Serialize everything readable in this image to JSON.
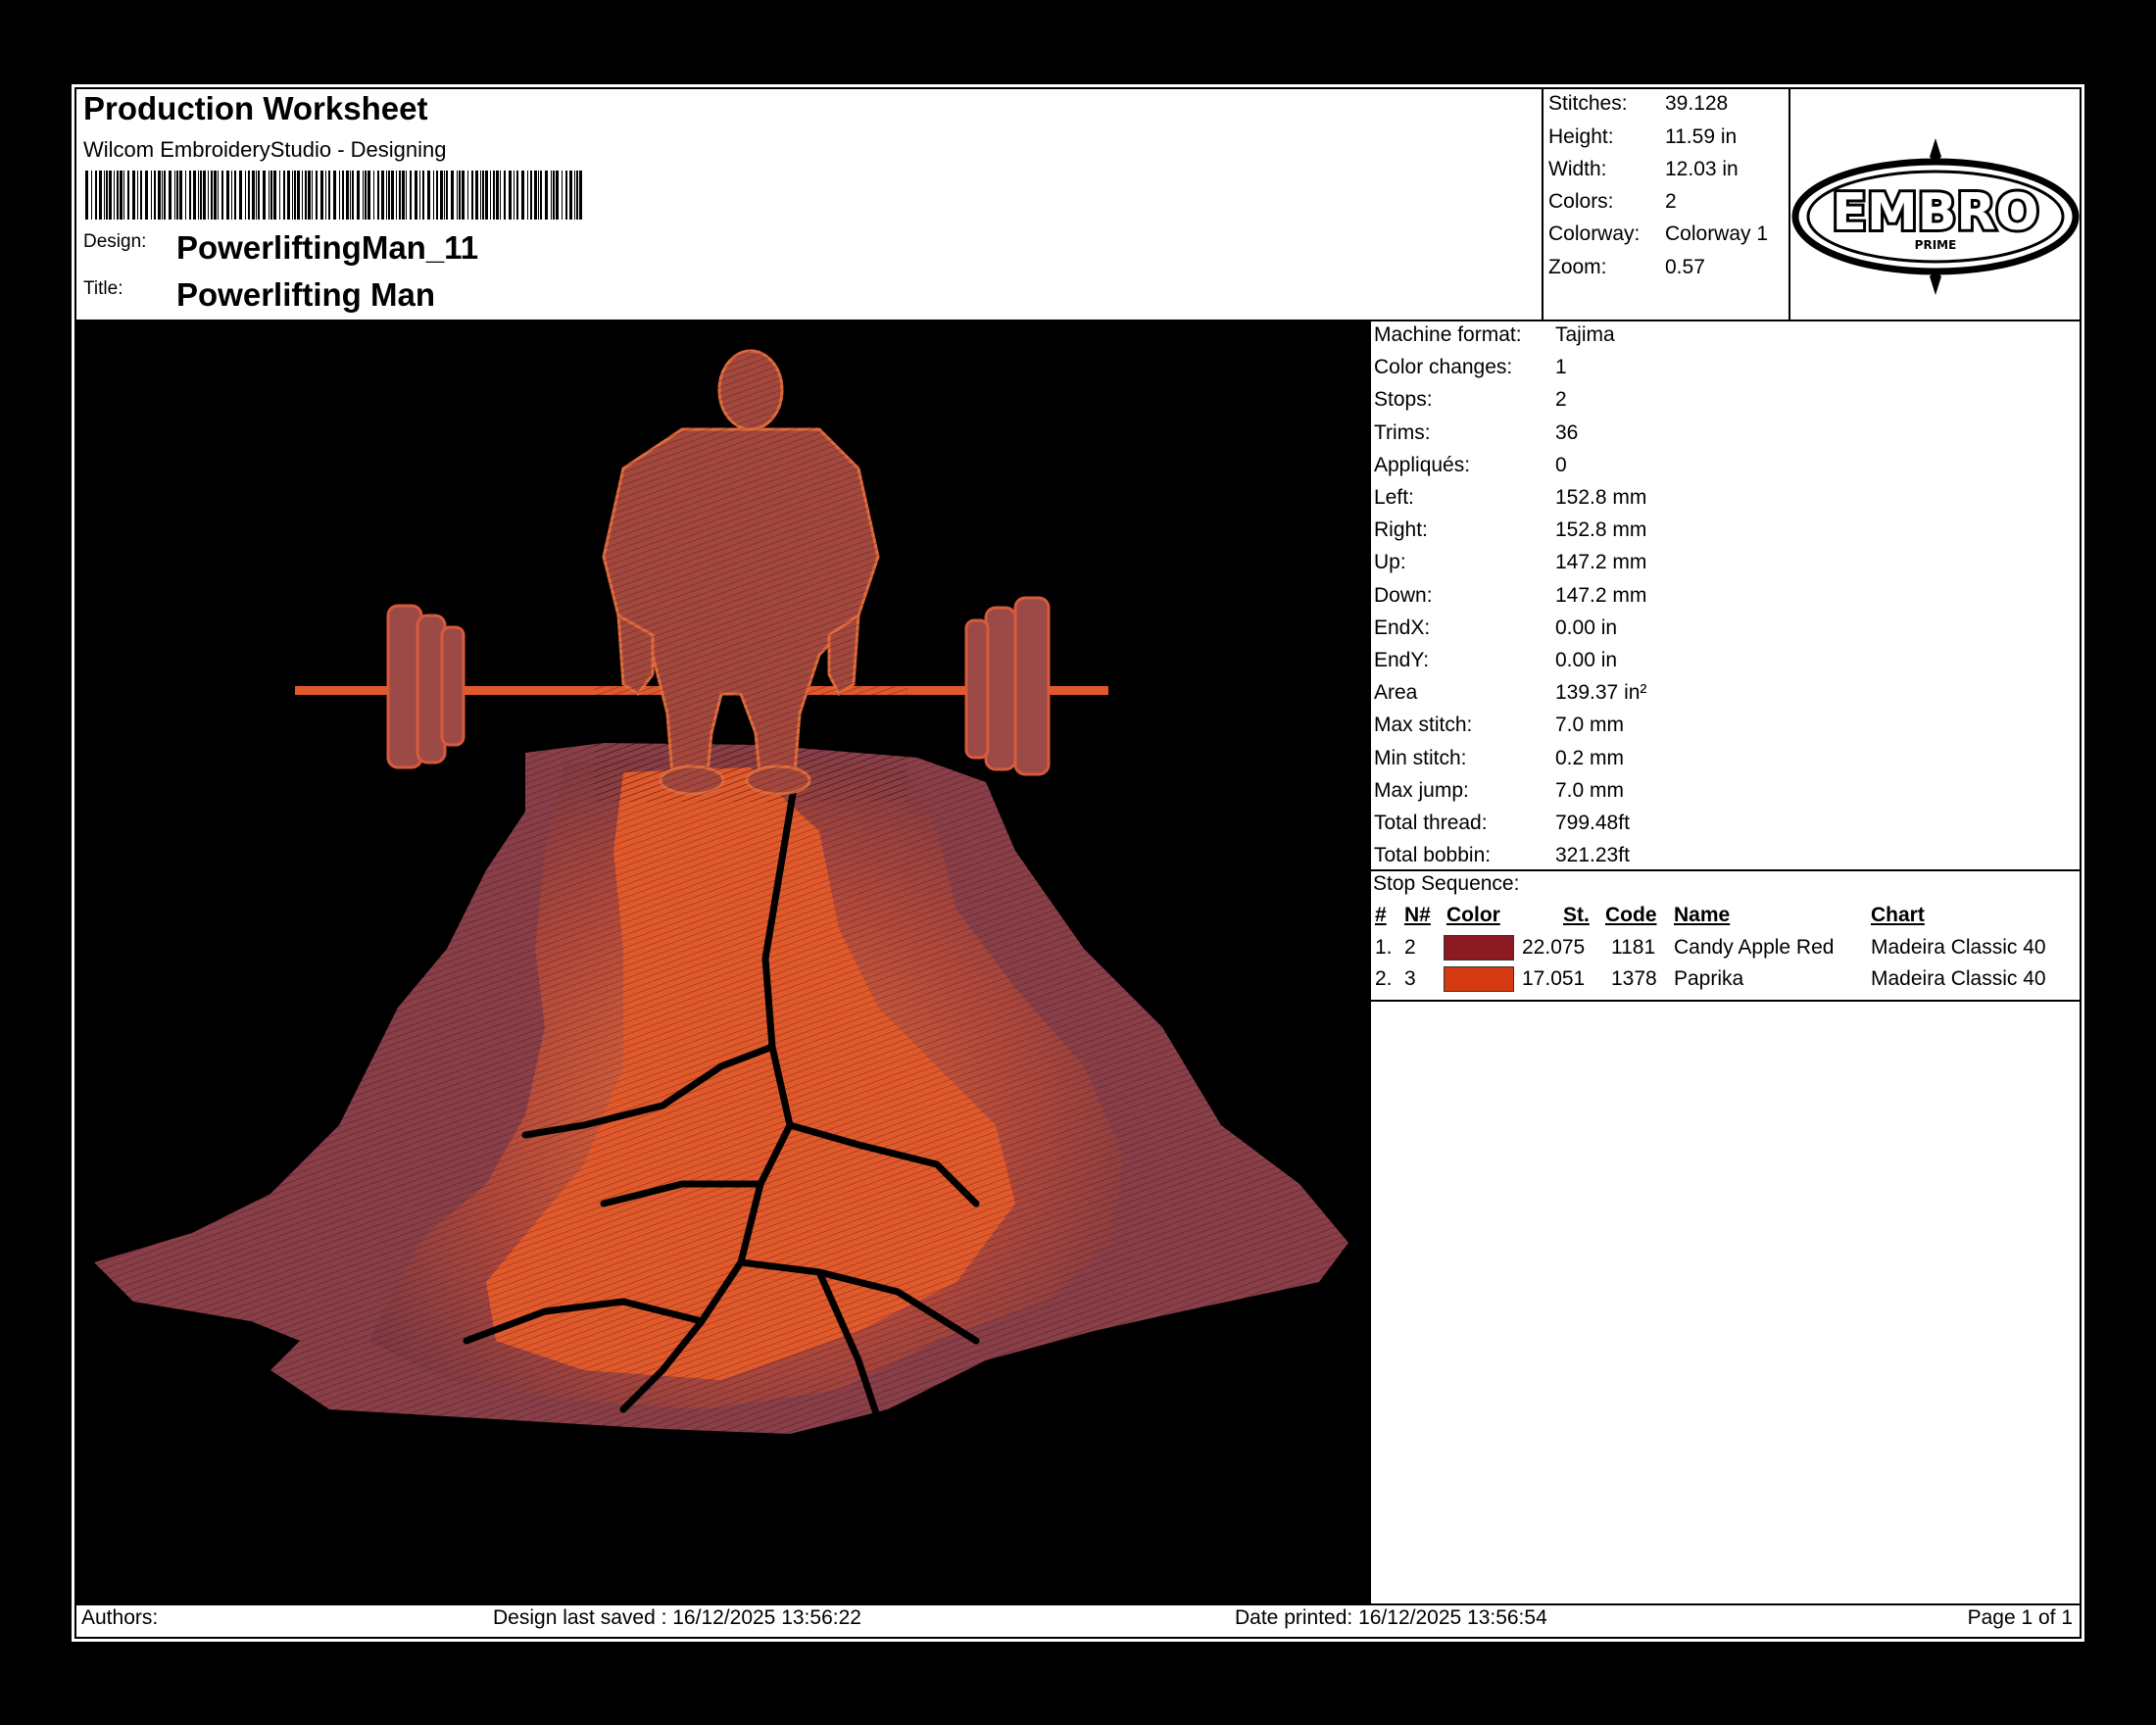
{
  "header": {
    "title": "Production Worksheet",
    "app": "Wilcom EmbroideryStudio - Designing",
    "design_label": "Design:",
    "design_value": "PowerliftingMan_11",
    "title_label": "Title:",
    "title_value": "Powerlifting Man"
  },
  "summary": [
    {
      "label": "Stitches:",
      "value": "39.128"
    },
    {
      "label": "Height:",
      "value": "11.59 in"
    },
    {
      "label": "Width:",
      "value": "12.03 in"
    },
    {
      "label": "Colors:",
      "value": "2"
    },
    {
      "label": "Colorway:",
      "value": "Colorway 1"
    },
    {
      "label": "Zoom:",
      "value": "0.57"
    }
  ],
  "logo": {
    "text": "EMBRO",
    "subtext": "PRIME"
  },
  "properties": [
    {
      "label": "Machine format:",
      "value": "Tajima"
    },
    {
      "label": "Color changes:",
      "value": "1"
    },
    {
      "label": "Stops:",
      "value": "2"
    },
    {
      "label": "Trims:",
      "value": "36"
    },
    {
      "label": "Appliqués:",
      "value": "0"
    },
    {
      "label": "Left:",
      "value": "152.8 mm"
    },
    {
      "label": "Right:",
      "value": "152.8 mm"
    },
    {
      "label": "Up:",
      "value": "147.2 mm"
    },
    {
      "label": "Down:",
      "value": "147.2 mm"
    },
    {
      "label": "EndX:",
      "value": "0.00 in"
    },
    {
      "label": "EndY:",
      "value": "0.00 in"
    },
    {
      "label": "Area",
      "value": "139.37 in²"
    },
    {
      "label": "Max stitch:",
      "value": "7.0 mm"
    },
    {
      "label": "Min stitch:",
      "value": "0.2 mm"
    },
    {
      "label": "Max jump:",
      "value": "7.0 mm"
    },
    {
      "label": "Total thread:",
      "value": "799.48ft"
    },
    {
      "label": "Total bobbin:",
      "value": "321.23ft"
    }
  ],
  "stop_sequence": {
    "title": "Stop Sequence:",
    "headers": {
      "num": "#",
      "needle": "N#",
      "color": "Color",
      "stitches": "St.",
      "code": "Code",
      "name": "Name",
      "chart": "Chart"
    },
    "rows": [
      {
        "num": "1.",
        "needle": "2",
        "color": "#8B1A22",
        "stitches": "22.075",
        "code": "1181",
        "name": "Candy Apple Red",
        "chart": "Madeira Classic 40"
      },
      {
        "num": "2.",
        "needle": "3",
        "color": "#D63A12",
        "stitches": "17.051",
        "code": "1378",
        "name": "Paprika",
        "chart": "Madeira Classic 40"
      }
    ]
  },
  "footer": {
    "authors": "Authors:",
    "saved": "Design last saved : 16/12/2025 13:56:22",
    "printed": "Date printed: 16/12/2025 13:56:54",
    "page": "Page 1 of 1"
  },
  "colors": {
    "thread1": "#8B1A22",
    "thread2": "#D63A12",
    "art_mid": "#9C4A48",
    "art_bright": "#E0582C"
  }
}
